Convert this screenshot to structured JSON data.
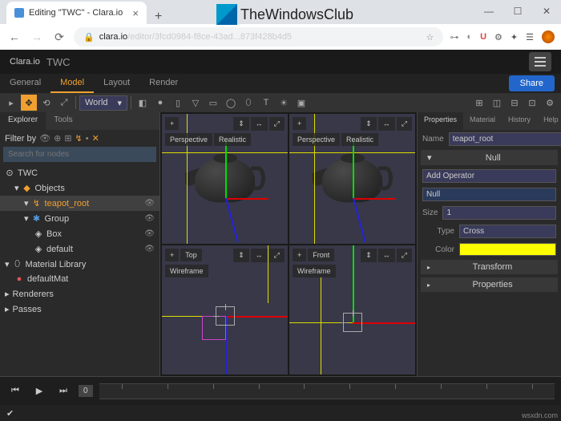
{
  "browser": {
    "tab_title": "Editing \"TWC\" - Clara.io",
    "url_host": "clara.io",
    "url_path": "/editor/3fcd0984-f8ce-43ad...873f428b4d5",
    "win_min": "—",
    "win_max": "☐",
    "win_close": "✕"
  },
  "watermark": "TheWindowsClub",
  "app_title": "Clara.io",
  "project_name": "TWC",
  "main_tabs": [
    "General",
    "Model",
    "Layout",
    "Render"
  ],
  "share": "Share",
  "coord_space": "World",
  "left": {
    "tabs": [
      "Explorer",
      "Tools"
    ],
    "filter_label": "Filter by",
    "search_placeholder": "Search for nodes",
    "tree": {
      "root": "TWC",
      "objects": "Objects",
      "teapot": "teapot_root",
      "group": "Group",
      "box": "Box",
      "default": "default",
      "matlib": "Material Library",
      "defaultmat": "defaultMat",
      "renderers": "Renderers",
      "passes": "Passes"
    }
  },
  "viewports": {
    "persp": "Perspective",
    "realistic": "Realistic",
    "top": "Top",
    "front": "Front",
    "wireframe": "Wireframe"
  },
  "right": {
    "tabs": [
      "Properties",
      "Material",
      "History",
      "Help"
    ],
    "name_label": "Name",
    "name_value": "teapot_root",
    "null_header": "Null",
    "add_op": "Add Operator",
    "null_item": "Null",
    "size_label": "Size",
    "size_value": "1",
    "type_label": "Type",
    "type_value": "Cross",
    "color_label": "Color",
    "color_hex": "#ffff00",
    "transform": "Transform",
    "properties": "Properties"
  },
  "timeline": {
    "frame": "0"
  },
  "source": "wsxdn.com"
}
